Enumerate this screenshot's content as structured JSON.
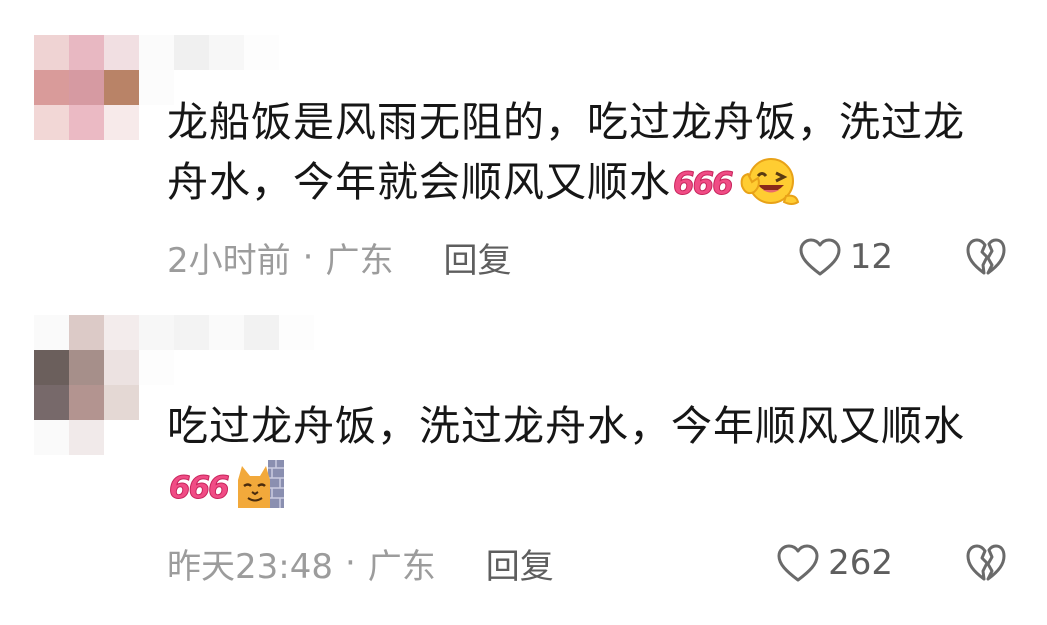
{
  "comments": [
    {
      "text": "龙船饭是风雨无阻的，吃过龙舟饭，洗过龙舟水，今年就会顺风又顺水",
      "emoji_text": "666",
      "emoji_icon": "grinning-wink-emoji-icon",
      "time": "2小时前",
      "location": "广东",
      "reply_label": "回复",
      "like_count": "12"
    },
    {
      "text": "吃过龙舟饭，洗过龙舟水，今年顺风又顺水",
      "emoji_text": "666",
      "emoji_icon": "cat-peeking-emoji-icon",
      "time": "昨天23:48",
      "location": "广东",
      "reply_label": "回复",
      "like_count": "262"
    }
  ],
  "separator": "·",
  "colors": {
    "text": "#161616",
    "meta": "#9c9c9c",
    "action": "#5e5e5e",
    "emoji666": "#f04c85"
  }
}
